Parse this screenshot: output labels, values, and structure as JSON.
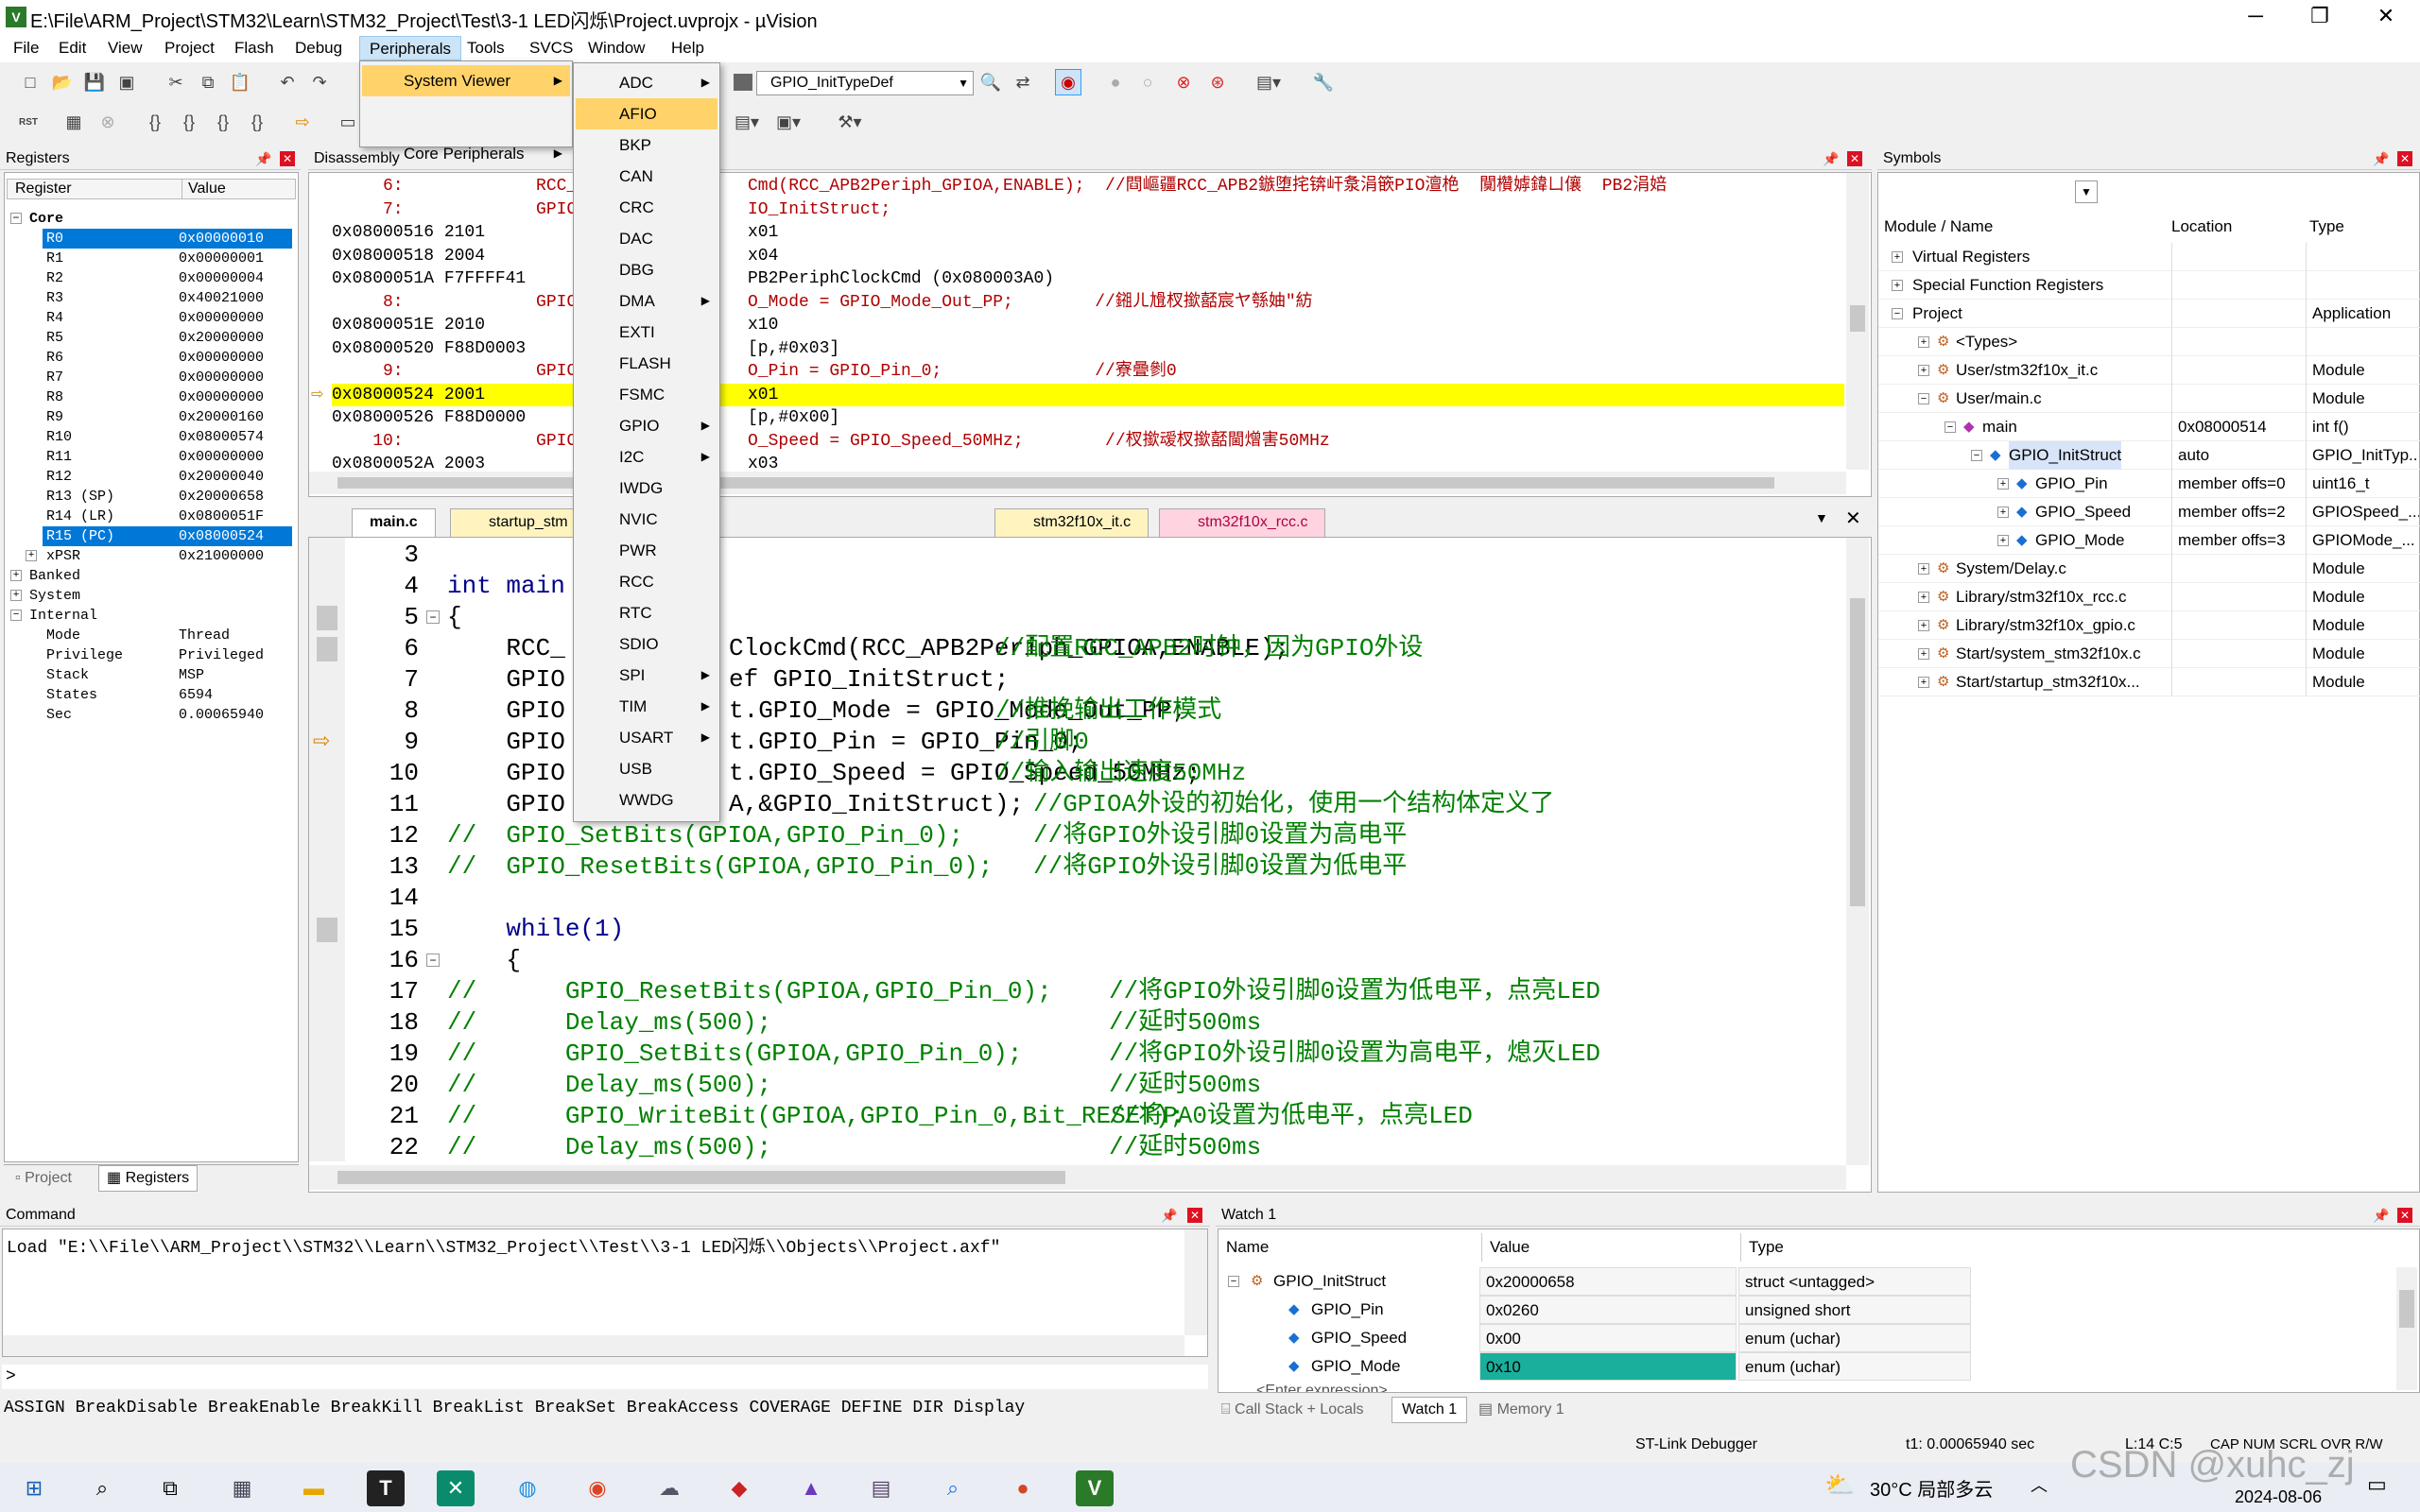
{
  "window": {
    "title": "E:\\File\\ARM_Project\\STM32\\Learn\\STM32_Project\\Test\\3-1 LED闪烁\\Project.uvprojx - µVision",
    "controls": [
      "─",
      "❐",
      "✕"
    ]
  },
  "menu": [
    "File",
    "Edit",
    "View",
    "Project",
    "Flash",
    "Debug",
    "Peripherals",
    "Tools",
    "SVCS",
    "Window",
    "Help"
  ],
  "peripherals_menu": {
    "items": [
      {
        "label": "System Viewer",
        "selected": true,
        "arrow": true
      },
      {
        "label": "Core Peripherals",
        "arrow": true
      }
    ],
    "submenu": [
      {
        "label": "ADC",
        "arrow": true
      },
      {
        "label": "AFIO",
        "selected": true
      },
      {
        "label": "BKP"
      },
      {
        "label": "CAN"
      },
      {
        "label": "CRC"
      },
      {
        "label": "DAC"
      },
      {
        "label": "DBG"
      },
      {
        "label": "DMA",
        "arrow": true
      },
      {
        "label": "EXTI"
      },
      {
        "label": "FLASH"
      },
      {
        "label": "FSMC"
      },
      {
        "label": "GPIO",
        "arrow": true
      },
      {
        "label": "I2C",
        "arrow": true
      },
      {
        "label": "IWDG"
      },
      {
        "label": "NVIC"
      },
      {
        "label": "PWR"
      },
      {
        "label": "RCC"
      },
      {
        "label": "RTC"
      },
      {
        "label": "SDIO"
      },
      {
        "label": "SPI",
        "arrow": true
      },
      {
        "label": "TIM",
        "arrow": true
      },
      {
        "label": "USART",
        "arrow": true
      },
      {
        "label": "USB"
      },
      {
        "label": "WWDG"
      }
    ]
  },
  "toolbar": {
    "combo_value": "GPIO_InitTypeDef",
    "rst": "RST"
  },
  "registers": {
    "title": "Registers",
    "headers": [
      "Register",
      "Value"
    ],
    "core_label": "Core",
    "rows": [
      {
        "name": "R0",
        "value": "0x00000010",
        "selected": true
      },
      {
        "name": "R1",
        "value": "0x00000001"
      },
      {
        "name": "R2",
        "value": "0x00000004"
      },
      {
        "name": "R3",
        "value": "0x40021000"
      },
      {
        "name": "R4",
        "value": "0x00000000"
      },
      {
        "name": "R5",
        "value": "0x20000000"
      },
      {
        "name": "R6",
        "value": "0x00000000"
      },
      {
        "name": "R7",
        "value": "0x00000000"
      },
      {
        "name": "R8",
        "value": "0x00000000"
      },
      {
        "name": "R9",
        "value": "0x20000160"
      },
      {
        "name": "R10",
        "value": "0x08000574"
      },
      {
        "name": "R11",
        "value": "0x00000000"
      },
      {
        "name": "R12",
        "value": "0x20000040"
      },
      {
        "name": "R13 (SP)",
        "value": "0x20000658"
      },
      {
        "name": "R14 (LR)",
        "value": "0x0800051F"
      },
      {
        "name": "R15 (PC)",
        "value": "0x08000524",
        "selected": true
      },
      {
        "name": "xPSR",
        "value": "0x21000000",
        "expander": true
      }
    ],
    "groups": [
      "Banked",
      "System",
      "Internal"
    ],
    "internal": [
      {
        "name": "Mode",
        "value": "Thread"
      },
      {
        "name": "Privilege",
        "value": "Privileged"
      },
      {
        "name": "Stack",
        "value": "MSP"
      },
      {
        "name": "States",
        "value": "6594"
      },
      {
        "name": "Sec",
        "value": "0.00065940"
      }
    ],
    "tabs": [
      "Project",
      "Registers"
    ]
  },
  "disassembly": {
    "title": "Disassembly",
    "lines": [
      {
        "text": "     6:             RCC_A",
        "rest": "Cmd(RCC_APB2Periph_GPIOA,ENABLE);  //閰嶇疆RCC_APB2鏃堕挓锛屽洜涓篏PIO澶栬  闃欑嫭鍏ㄩ儴  PB2涓婄",
        "src": true
      },
      {
        "text": "     7:             GPIO_",
        "rest": "IO_InitStruct;",
        "src": true
      },
      {
        "text": "0x08000516 2101      ",
        "rest": "x01"
      },
      {
        "text": "0x08000518 2004      ",
        "rest": "x04"
      },
      {
        "text": "0x0800051A F7FFFF41  ",
        "rest": "PB2PeriphClockCmd (0x080003A0)"
      },
      {
        "text": "     8:             GPIO_",
        "rest": "O_Mode = GPIO_Mode_Out_PP;        //鎺ㄦ尳杈撳嚭宸ヤ綔妯″紡",
        "src": true
      },
      {
        "text": "0x0800051E 2010      ",
        "rest": "x10"
      },
      {
        "text": "0x08000520 F88D0003  ",
        "rest": "[p,#0x03]"
      },
      {
        "text": "     9:             GPIO_",
        "rest": "O_Pin = GPIO_Pin_0;               //寮曡剼0",
        "src": true
      },
      {
        "text": "0x08000524 2001      ",
        "rest": "x01",
        "current": true
      },
      {
        "text": "0x08000526 F88D0000  ",
        "rest": "[p,#0x00]"
      },
      {
        "text": "    10:             GPIO_",
        "rest": "O_Speed = GPIO_Speed_50MHz;        //杈撳叆杈撳嚭閫熷害50MHz",
        "src": true
      },
      {
        "text": "0x0800052A 2003      ",
        "rest": "x03"
      }
    ]
  },
  "editor": {
    "tabs": [
      {
        "label": "main.c",
        "active": true
      },
      {
        "label": "startup_stm"
      },
      {
        "label": "stm32f10x_it.c"
      },
      {
        "label": "stm32f10x_rcc.c"
      }
    ],
    "lines": [
      {
        "n": "3",
        "code": ""
      },
      {
        "n": "4",
        "code": "int main"
      },
      {
        "n": "5",
        "code": "{"
      },
      {
        "n": "6",
        "code": "    RCC_",
        "rest": "ClockCmd(RCC_APB2Periph_GPIOA,ENABLE);",
        "comment": "//配置RCC_APB2时钟，因为GPIO外设"
      },
      {
        "n": "7",
        "code": "    GPIO",
        "rest": "ef GPIO_InitStruct;"
      },
      {
        "n": "8",
        "code": "    GPIO",
        "rest": "t.GPIO_Mode = GPIO_Mode_Out_PP;",
        "comment": "//推挽输出工作模式"
      },
      {
        "n": "9",
        "code": "    GPIO",
        "rest": "t.GPIO_Pin = GPIO_Pin_0;",
        "comment": "//引脚0"
      },
      {
        "n": "10",
        "code": "    GPIO",
        "rest": "t.GPIO_Speed = GPIO_Speed_50MHz;",
        "comment": "//输入输出速度50MHz"
      },
      {
        "n": "11",
        "code": "    GPIO",
        "rest": "A,&GPIO_InitStruct);",
        "comment": "//GPIOA外设的初始化，使用一个结构体定义了"
      },
      {
        "n": "12",
        "code": "//  GPIO_SetBits(GPIOA,GPIO_Pin_0);",
        "comment": "//将GPIO外设引脚0设置为高电平"
      },
      {
        "n": "13",
        "code": "//  GPIO_ResetBits(GPIOA,GPIO_Pin_0);",
        "comment": "//将GPIO外设引脚0设置为低电平"
      },
      {
        "n": "14",
        "code": ""
      },
      {
        "n": "15",
        "code": "    while(1)"
      },
      {
        "n": "16",
        "code": "    {"
      },
      {
        "n": "17",
        "code": "//      GPIO_ResetBits(GPIOA,GPIO_Pin_0);",
        "comment": "//将GPIO外设引脚0设置为低电平，点亮LED"
      },
      {
        "n": "18",
        "code": "//      Delay_ms(500);",
        "comment": "//延时500ms"
      },
      {
        "n": "19",
        "code": "//      GPIO_SetBits(GPIOA,GPIO_Pin_0);",
        "comment": "//将GPIO外设引脚0设置为高电平，熄灭LED"
      },
      {
        "n": "20",
        "code": "//      Delay_ms(500);",
        "comment": "//延时500ms"
      },
      {
        "n": "21",
        "code": "//      GPIO_WriteBit(GPIOA,GPIO_Pin_0,Bit_RESET);",
        "comment": "//将PA0设置为低电平，点亮LED"
      },
      {
        "n": "22",
        "code": "//      Delay_ms(500);",
        "comment": "//延时500ms"
      }
    ]
  },
  "symbols": {
    "title": "Symbols",
    "headers": [
      "Module / Name",
      "Location",
      "Type"
    ],
    "rows": [
      {
        "name": "Virtual Registers",
        "loc": "",
        "type": "",
        "indent": 0
      },
      {
        "name": "Special Function Registers",
        "loc": "",
        "type": "",
        "indent": 0
      },
      {
        "name": "Project",
        "loc": "",
        "type": "Application",
        "indent": 0
      },
      {
        "name": "<Types>",
        "loc": "",
        "type": "",
        "indent": 1
      },
      {
        "name": "User/stm32f10x_it.c",
        "loc": "",
        "type": "Module",
        "indent": 1
      },
      {
        "name": "User/main.c",
        "loc": "",
        "type": "Module",
        "indent": 1
      },
      {
        "name": "main",
        "loc": "0x08000514",
        "type": "int f()",
        "indent": 2
      },
      {
        "name": "GPIO_InitStruct",
        "loc": "auto",
        "type": "GPIO_InitTyp...",
        "indent": 3,
        "selected": true
      },
      {
        "name": "GPIO_Pin",
        "loc": "member offs=0",
        "type": "uint16_t",
        "indent": 4
      },
      {
        "name": "GPIO_Speed",
        "loc": "member offs=2",
        "type": "GPIOSpeed_...",
        "indent": 4
      },
      {
        "name": "GPIO_Mode",
        "loc": "member offs=3",
        "type": "GPIOMode_...",
        "indent": 4
      },
      {
        "name": "System/Delay.c",
        "loc": "",
        "type": "Module",
        "indent": 1
      },
      {
        "name": "Library/stm32f10x_rcc.c",
        "loc": "",
        "type": "Module",
        "indent": 1
      },
      {
        "name": "Library/stm32f10x_gpio.c",
        "loc": "",
        "type": "Module",
        "indent": 1
      },
      {
        "name": "Start/system_stm32f10x.c",
        "loc": "",
        "type": "Module",
        "indent": 1
      },
      {
        "name": "Start/startup_stm32f10x...",
        "loc": "",
        "type": "Module",
        "indent": 1
      }
    ]
  },
  "command": {
    "title": "Command",
    "output": "Load \"E:\\\\File\\\\ARM_Project\\\\STM32\\\\Learn\\\\STM32_Project\\\\Test\\\\3-1 LED闪烁\\\\Objects\\\\Project.axf\"",
    "prompt": ">",
    "hints": "ASSIGN BreakDisable BreakEnable BreakKill BreakList BreakSet BreakAccess COVERAGE DEFINE DIR Display"
  },
  "watch": {
    "title": "Watch 1",
    "headers": [
      "Name",
      "Value",
      "Type"
    ],
    "rows": [
      {
        "name": "GPIO_InitStruct",
        "value": "0x20000658",
        "type": "struct <untagged>",
        "indent": 0
      },
      {
        "name": "GPIO_Pin",
        "value": "0x0260",
        "type": "unsigned short",
        "indent": 1
      },
      {
        "name": "GPIO_Speed",
        "value": "0x00",
        "type": "enum (uchar)",
        "indent": 1
      },
      {
        "name": "GPIO_Mode",
        "value": "0x10",
        "type": "enum (uchar)",
        "indent": 1,
        "highlight": true
      }
    ],
    "enter_expr": "<Enter expression>",
    "tabs": [
      "Call Stack + Locals",
      "Watch 1",
      "Memory 1"
    ]
  },
  "status": {
    "debugger": "ST-Link Debugger",
    "time": "t1: 0.00065940 sec",
    "pos": "L:14 C:5",
    "flags": "CAP  NUM  SCRL  OVR  R/W"
  },
  "taskbar": {
    "weather": "30°C 局部多云",
    "date": "2024-08-06",
    "watermark": "CSDN @xuhc_zj"
  },
  "colors": {
    "selection": "#0078d7",
    "current_line": "#ffff00",
    "menu_highlight": "#ffd36a",
    "watch_highlight": "#1aaf9c"
  }
}
